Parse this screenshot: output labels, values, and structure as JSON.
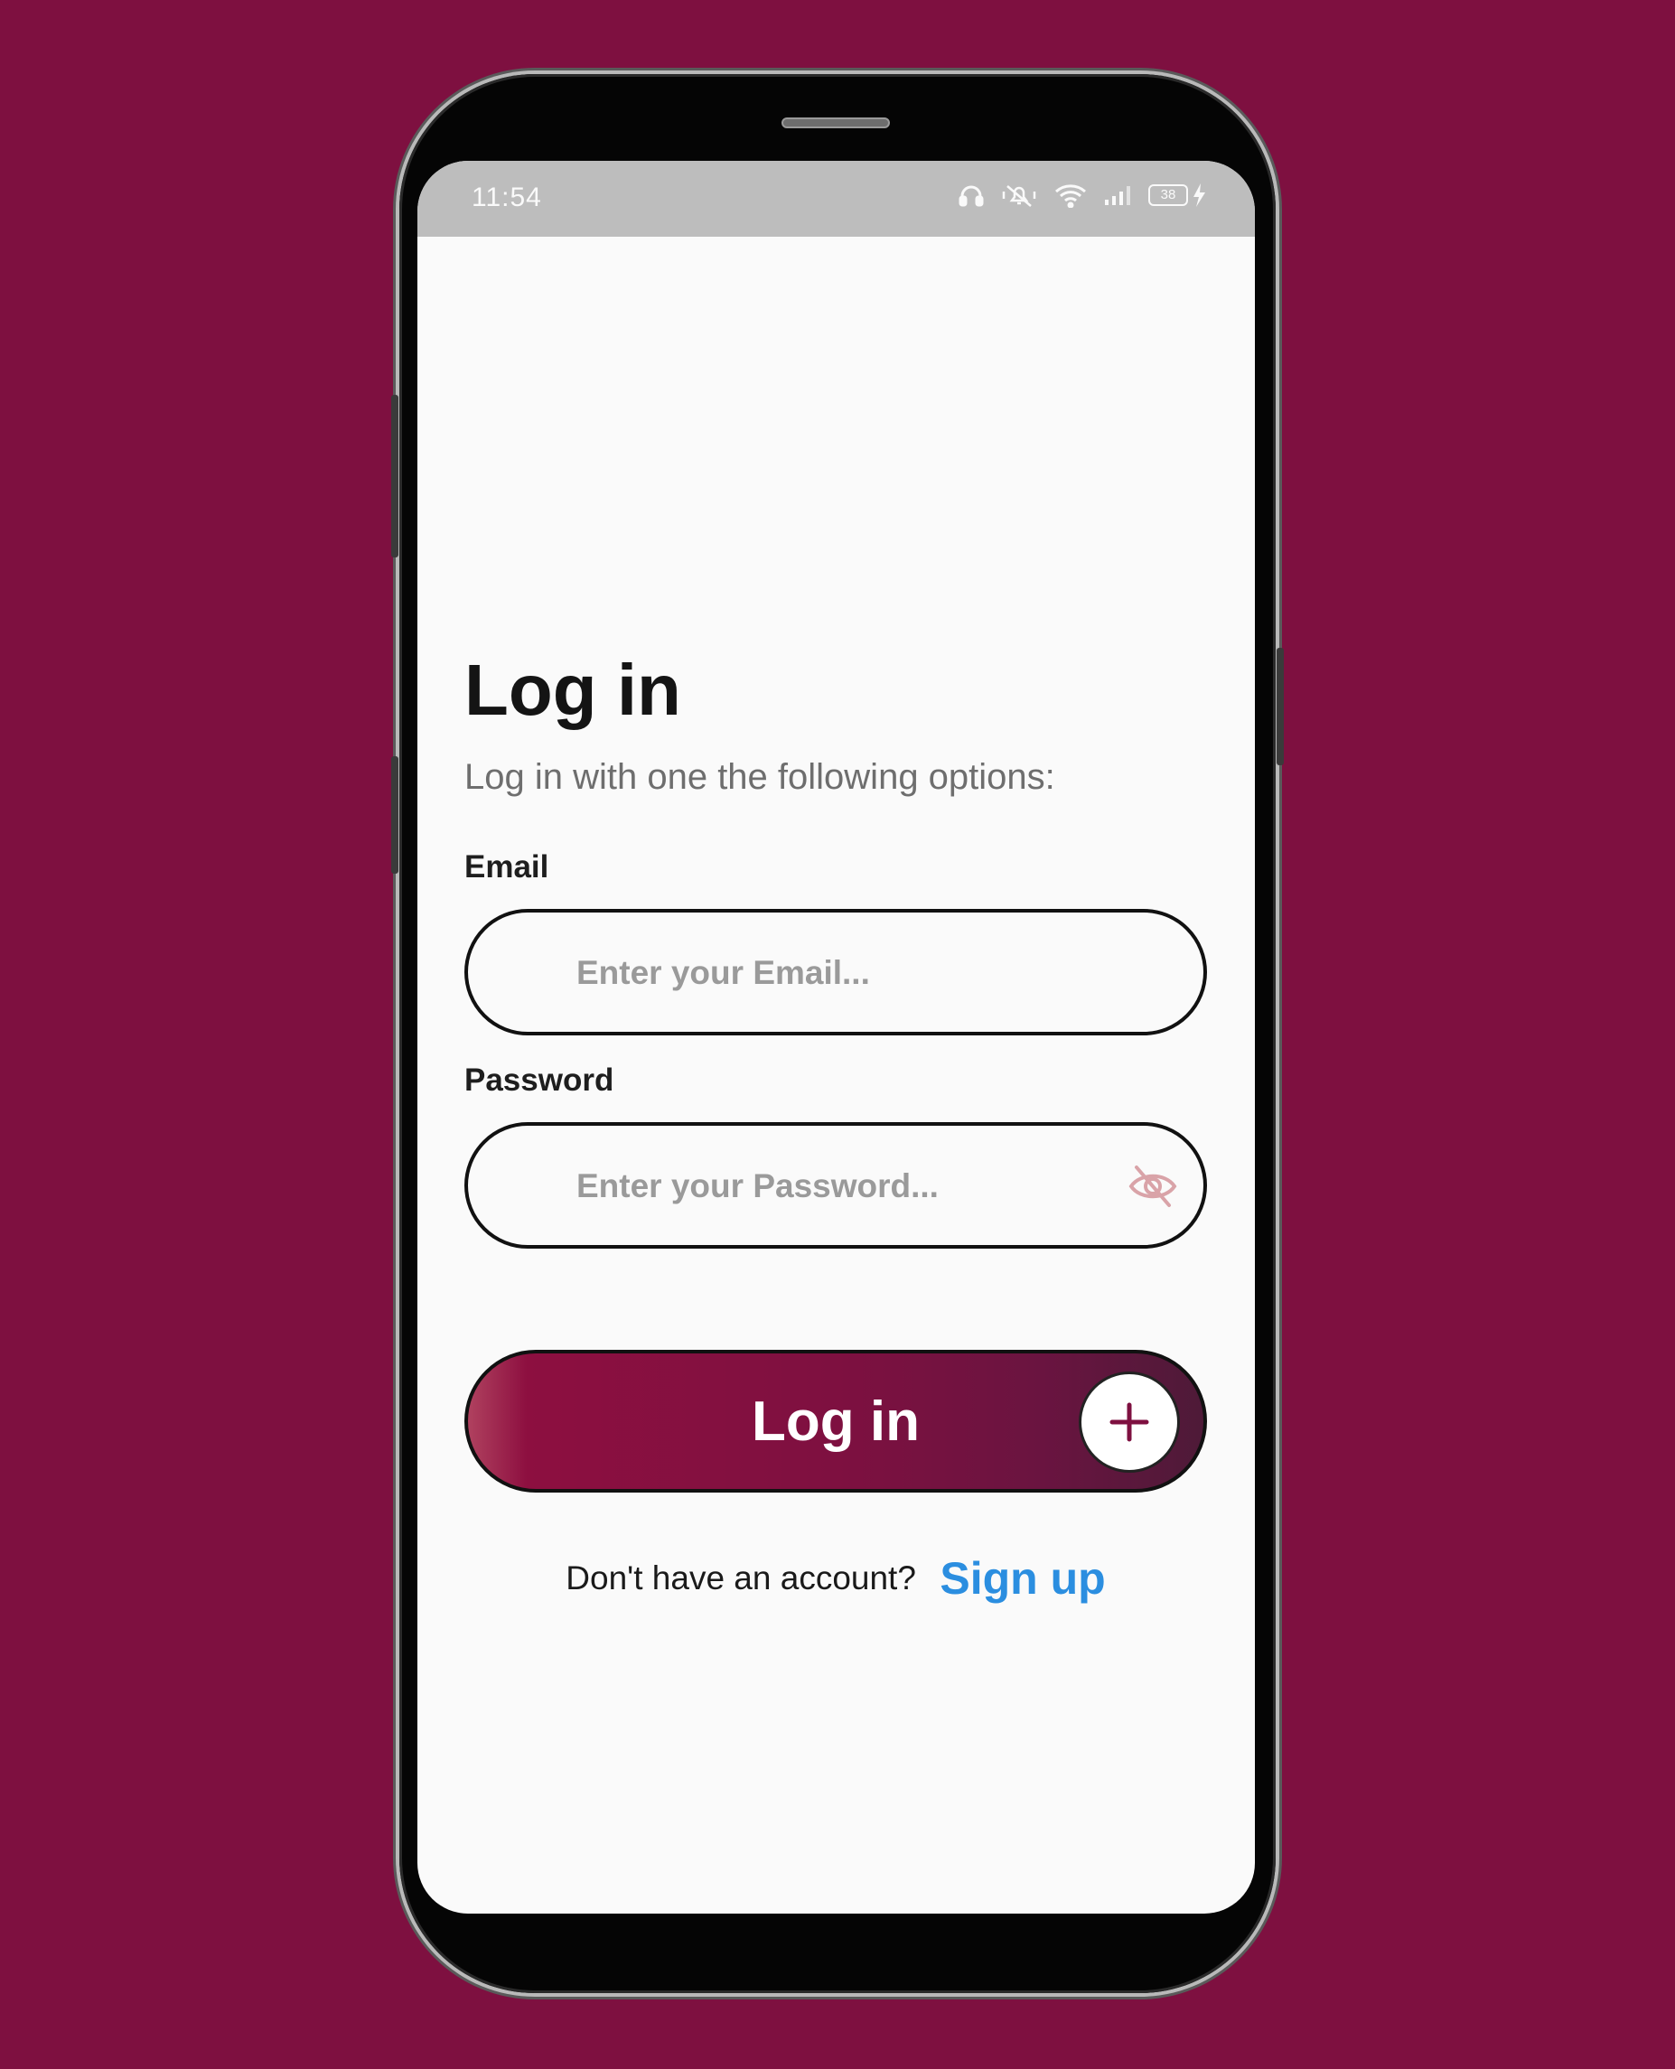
{
  "status_bar": {
    "time": "11:54",
    "battery_level": "38",
    "icons": [
      "headphones-icon",
      "mute-icon",
      "wifi-icon",
      "signal-icon",
      "battery-icon",
      "charging-icon"
    ]
  },
  "login": {
    "title": "Log in",
    "subtitle": "Log in with one the following options:",
    "email_label": "Email",
    "email_placeholder": "Enter your Email...",
    "email_value": "",
    "password_label": "Password",
    "password_placeholder": "Enter your Password...",
    "password_value": "",
    "submit_label": "Log in",
    "no_account_text": "Don't have an account?",
    "signup_label": "Sign up"
  },
  "colors": {
    "background": "#7e1040",
    "accent": "#7e1040",
    "link": "#2b8ee0"
  }
}
